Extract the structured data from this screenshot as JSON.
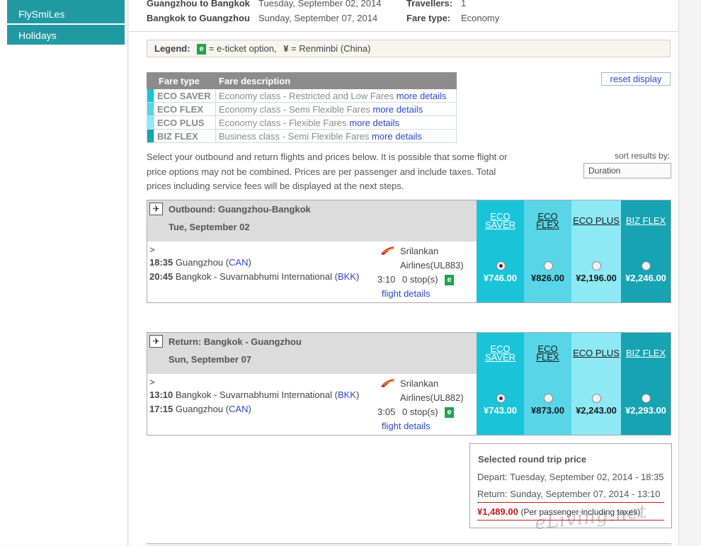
{
  "sidebar": {
    "items": [
      {
        "label": "FlySmiLes"
      },
      {
        "label": "Holidays"
      }
    ]
  },
  "trip": {
    "row1_route": "Guangzhou to Bangkok",
    "row1_date": "Tuesday, September 02, 2014",
    "row2_route": "Bangkok to Guangzhou",
    "row2_date": "Sunday, September 07, 2014",
    "travellers_label": "Travellers:",
    "travellers_value": "1",
    "fare_type_label": "Fare type:",
    "fare_type_value": "Economy"
  },
  "legend": {
    "title": "Legend:",
    "badge": "e",
    "eticket_text": "= e-ticket option,",
    "yen_symbol": "¥",
    "yen_text": "= Renminbi (China)"
  },
  "fare_table": {
    "header_type": "Fare type",
    "header_desc": "Fare description",
    "link_label": "more details",
    "rows": [
      {
        "name": "ECO SAVER",
        "desc": "Economy class - Restricted and Low Fares",
        "color": "#19c4d9"
      },
      {
        "name": "ECO FLEX",
        "desc": "Economy class - Semi Flexible Fares",
        "color": "#58d6e7"
      },
      {
        "name": "ECO PLUS",
        "desc": "Economy class - Flexible Fares",
        "color": "#8de9f4"
      },
      {
        "name": "BIZ FLEX",
        "desc": "Business class - Semi Flexible Fares",
        "color": "#16a3b2"
      }
    ]
  },
  "reset_label": "reset display",
  "intro": "Select your outbound and return flights and prices below. It is possible that some flight or price options may not be combined. Prices are per passenger and include taxes. Total prices including service fees will be displayed at the next steps.",
  "sort": {
    "label": "sort results by:",
    "value": "Duration"
  },
  "fare_headers": {
    "eco_saver_1": "ECO",
    "eco_saver_2": "SAVER",
    "eco_flex_1": "ECO",
    "eco_flex_2": "FLEX",
    "eco_plus": "ECO PLUS",
    "biz_flex": "BIZ FLEX"
  },
  "outbound": {
    "title": "Outbound: Guangzhou-Bangkok",
    "date": "Tue, September 02",
    "expand": ">",
    "dep_time": "18:35",
    "dep_city": "Guangzhou (",
    "dep_code": "CAN",
    "dep_close": ")",
    "arr_time": "20:45",
    "arr_city": "Bangkok - Suvarnabhumi International (",
    "arr_code": "BKK",
    "arr_close": ")",
    "airline_1": "Srilankan",
    "airline_2": "Airlines(UL883)",
    "duration": "3:10",
    "stops": "0 stop(s)",
    "details_link": "flight details",
    "prices": [
      "¥746.00",
      "¥826.00",
      "¥2,196.00",
      "¥2,246.00"
    ],
    "selected_index": 0
  },
  "return": {
    "title": "Return: Bangkok - Guangzhou",
    "date": "Sun, September 07",
    "expand": ">",
    "dep_time": "13:10",
    "dep_city": "Bangkok - Suvarnabhumi International (",
    "dep_code": "BKK",
    "dep_close": ")",
    "arr_time": "17:15",
    "arr_city": "Guangzhou (",
    "arr_code": "CAN",
    "arr_close": ")",
    "airline_1": "Srilankan",
    "airline_2": "Airlines(UL882)",
    "duration": "3:05",
    "stops": "0 stop(s)",
    "details_link": "flight details",
    "prices": [
      "¥743.00",
      "¥873.00",
      "¥2,243.00",
      "¥2,293.00"
    ],
    "selected_index": 0
  },
  "summary": {
    "title": "Selected round trip price",
    "depart": "Depart: Tuesday, September 02, 2014 - 18:35",
    "return": "Return: Sunday, September 07, 2014 - 13:10",
    "total": "¥1,489.00",
    "note": "(Per passenger including taxes)"
  },
  "watermark": "eLiving.net"
}
